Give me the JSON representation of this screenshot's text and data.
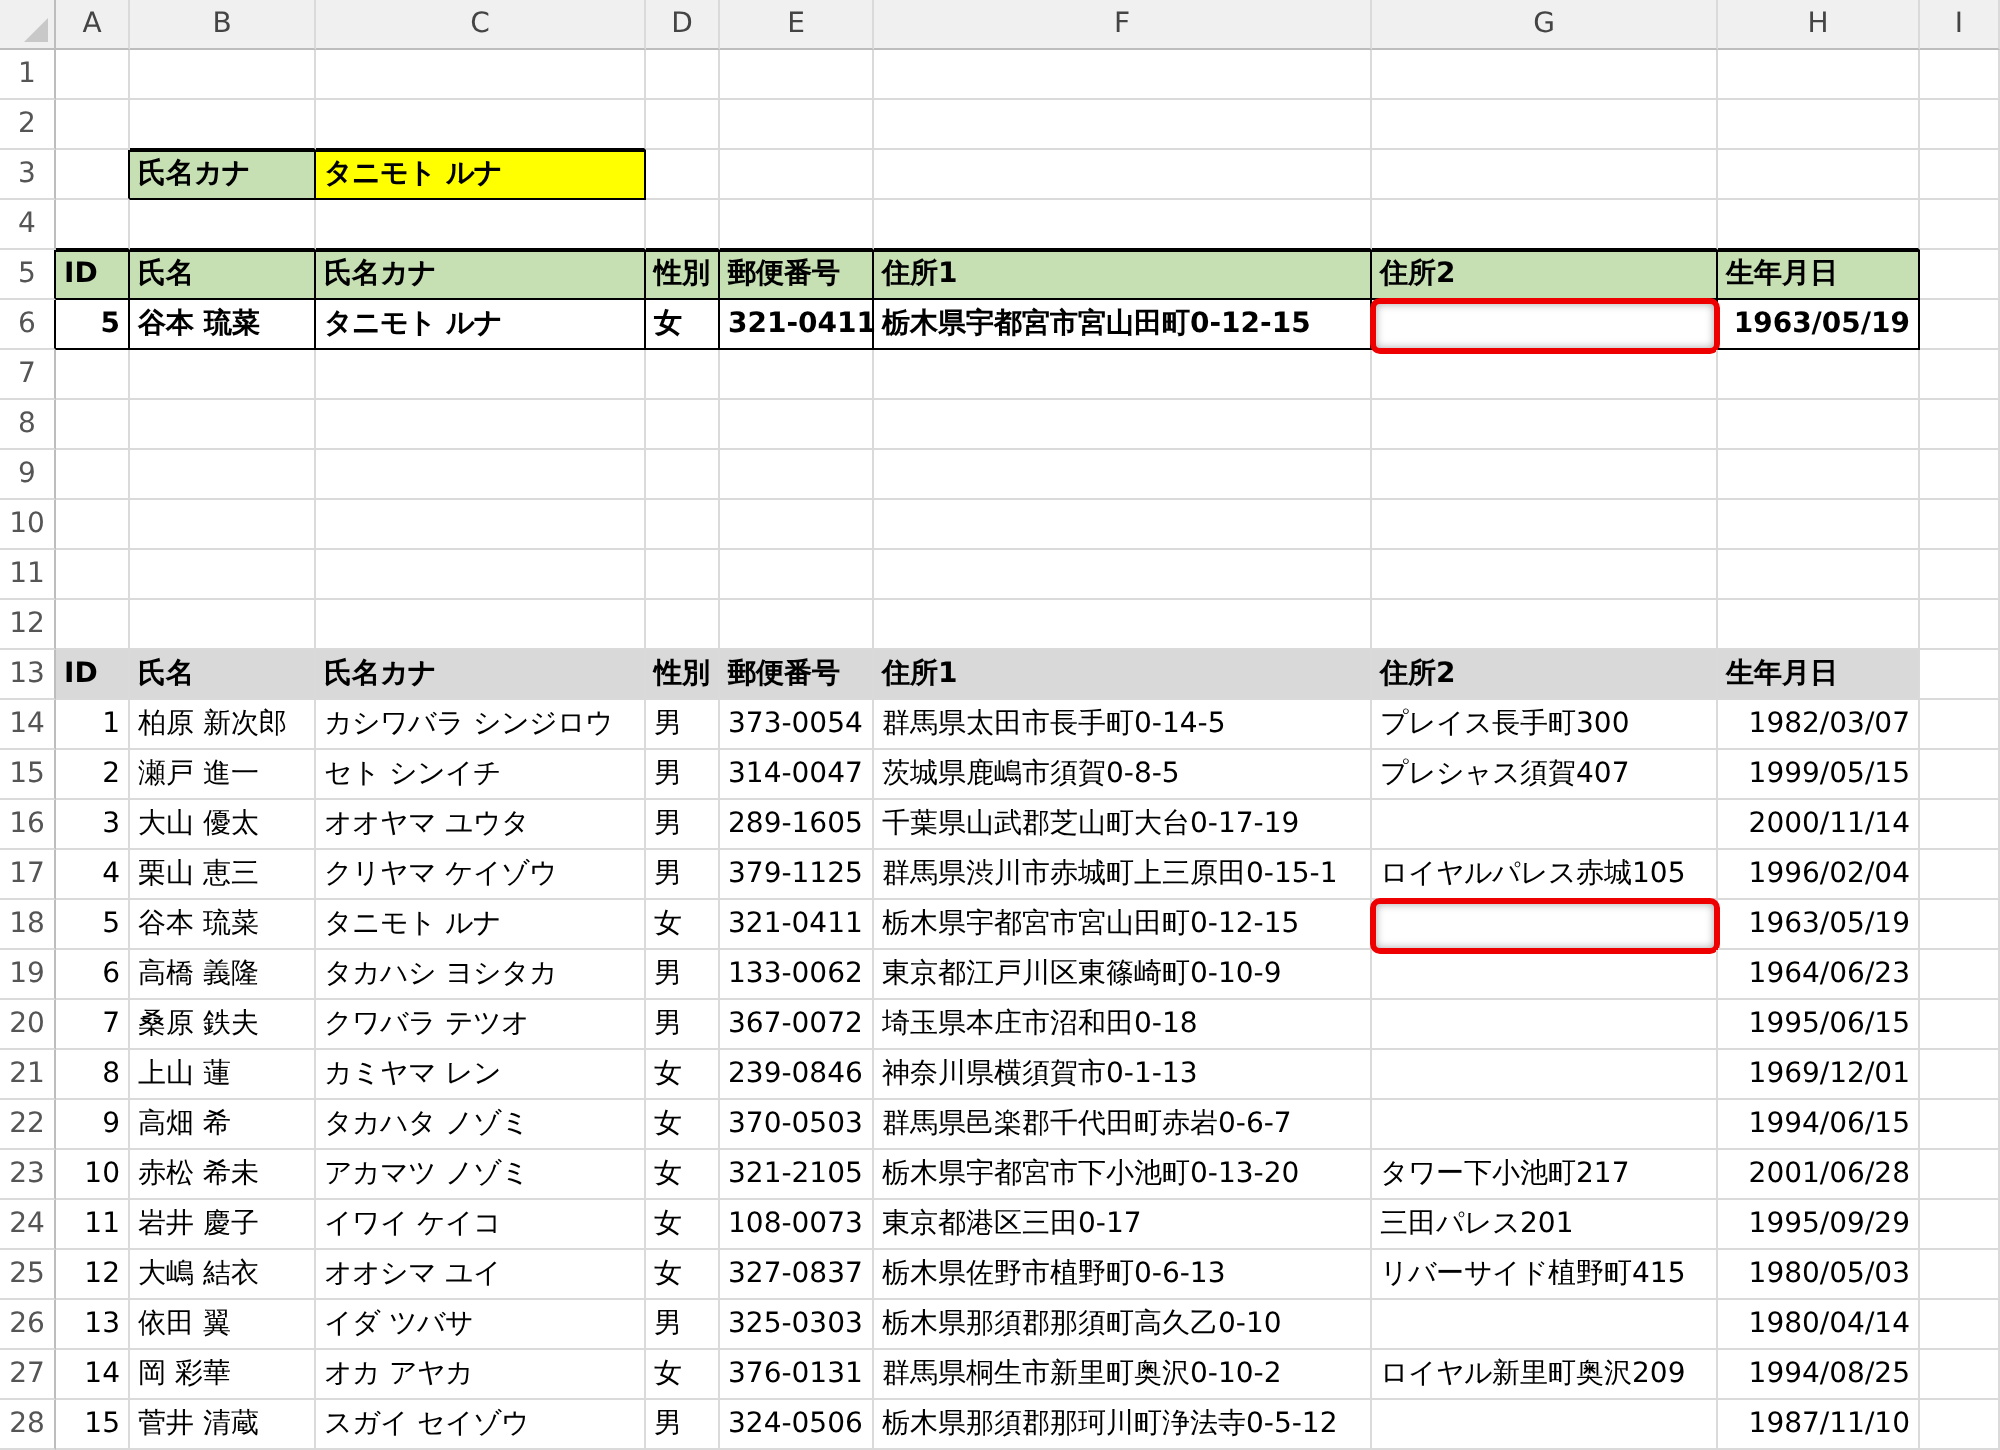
{
  "column_headers": [
    "A",
    "B",
    "C",
    "D",
    "E",
    "F",
    "G",
    "H",
    "I"
  ],
  "row_numbers": [
    "1",
    "2",
    "3",
    "4",
    "5",
    "6",
    "7",
    "8",
    "9",
    "10",
    "11",
    "12",
    "13",
    "14",
    "15",
    "16",
    "17",
    "18",
    "19",
    "20",
    "21",
    "22",
    "23",
    "24",
    "25",
    "26",
    "27",
    "28"
  ],
  "lookup": {
    "label": "氏名カナ",
    "value": "タニモト ルナ"
  },
  "result_table": {
    "columns": [
      "ID",
      "氏名",
      "氏名カナ",
      "性別",
      "郵便番号",
      "住所1",
      "住所2",
      "生年月日"
    ],
    "row": {
      "id": "5",
      "name": "谷本 琉菜",
      "kana": "タニモト ルナ",
      "gender": "女",
      "postal": "321-0411",
      "address1": "栃木県宇都宮市宮山田町0-12-15",
      "birthdate": "1963/05/19",
      "address2_highlighted": true
    }
  },
  "data_table": {
    "columns": [
      "ID",
      "氏名",
      "氏名カナ",
      "性別",
      "郵便番号",
      "住所1",
      "住所2",
      "生年月日"
    ],
    "rows": [
      {
        "id": "1",
        "name": "柏原 新次郎",
        "kana": "カシワバラ シンジロウ",
        "gender": "男",
        "postal": "373-0054",
        "address1": "群馬県太田市長手町0-14-5",
        "address2": "プレイス長手町300",
        "birthdate": "1982/03/07",
        "address2_highlighted": false
      },
      {
        "id": "2",
        "name": "瀬戸 進一",
        "kana": "セト シンイチ",
        "gender": "男",
        "postal": "314-0047",
        "address1": "茨城県鹿嶋市須賀0-8-5",
        "address2": "プレシャス須賀407",
        "birthdate": "1999/05/15",
        "address2_highlighted": false
      },
      {
        "id": "3",
        "name": "大山 優太",
        "kana": "オオヤマ ユウタ",
        "gender": "男",
        "postal": "289-1605",
        "address1": "千葉県山武郡芝山町大台0-17-19",
        "birthdate": "2000/11/14",
        "address2_highlighted": false
      },
      {
        "id": "4",
        "name": "栗山 恵三",
        "kana": "クリヤマ ケイゾウ",
        "gender": "男",
        "postal": "379-1125",
        "address1": "群馬県渋川市赤城町上三原田0-15-1",
        "address2": "ロイヤルパレス赤城105",
        "birthdate": "1996/02/04",
        "address2_highlighted": false
      },
      {
        "id": "5",
        "name": "谷本 琉菜",
        "kana": "タニモト ルナ",
        "gender": "女",
        "postal": "321-0411",
        "address1": "栃木県宇都宮市宮山田町0-12-15",
        "birthdate": "1963/05/19",
        "address2_highlighted": true
      },
      {
        "id": "6",
        "name": "高橋 義隆",
        "kana": "タカハシ ヨシタカ",
        "gender": "男",
        "postal": "133-0062",
        "address1": "東京都江戸川区東篠崎町0-10-9",
        "birthdate": "1964/06/23",
        "address2_highlighted": false
      },
      {
        "id": "7",
        "name": "桑原 鉄夫",
        "kana": "クワバラ テツオ",
        "gender": "男",
        "postal": "367-0072",
        "address1": "埼玉県本庄市沼和田0-18",
        "birthdate": "1995/06/15",
        "address2_highlighted": false
      },
      {
        "id": "8",
        "name": "上山 蓮",
        "kana": "カミヤマ レン",
        "gender": "女",
        "postal": "239-0846",
        "address1": "神奈川県横須賀市0-1-13",
        "birthdate": "1969/12/01",
        "address2_highlighted": false
      },
      {
        "id": "9",
        "name": "高畑 希",
        "kana": "タカハタ ノゾミ",
        "gender": "女",
        "postal": "370-0503",
        "address1": "群馬県邑楽郡千代田町赤岩0-6-7",
        "birthdate": "1994/06/15",
        "address2_highlighted": false
      },
      {
        "id": "10",
        "name": "赤松 希未",
        "kana": "アカマツ ノゾミ",
        "gender": "女",
        "postal": "321-2105",
        "address1": "栃木県宇都宮市下小池町0-13-20",
        "address2": "タワー下小池町217",
        "birthdate": "2001/06/28",
        "address2_highlighted": false
      },
      {
        "id": "11",
        "name": "岩井 慶子",
        "kana": "イワイ ケイコ",
        "gender": "女",
        "postal": "108-0073",
        "address1": "東京都港区三田0-17",
        "address2": "三田パレス201",
        "birthdate": "1995/09/29",
        "address2_highlighted": false
      },
      {
        "id": "12",
        "name": "大嶋 結衣",
        "kana": "オオシマ ユイ",
        "gender": "女",
        "postal": "327-0837",
        "address1": "栃木県佐野市植野町0-6-13",
        "address2": "リバーサイド植野町415",
        "birthdate": "1980/05/03",
        "address2_highlighted": false
      },
      {
        "id": "13",
        "name": "依田 翼",
        "kana": "イダ ツバサ",
        "gender": "男",
        "postal": "325-0303",
        "address1": "栃木県那須郡那須町高久乙0-10",
        "birthdate": "1980/04/14",
        "address2_highlighted": false
      },
      {
        "id": "14",
        "name": "岡 彩華",
        "kana": "オカ アヤカ",
        "gender": "女",
        "postal": "376-0131",
        "address1": "群馬県桐生市新里町奥沢0-10-2",
        "address2": "ロイヤル新里町奥沢209",
        "birthdate": "1994/08/25",
        "address2_highlighted": false
      },
      {
        "id": "15",
        "name": "菅井 清蔵",
        "kana": "スガイ セイゾウ",
        "gender": "男",
        "postal": "324-0506",
        "address1": "栃木県那須郡那珂川町浄法寺0-5-12",
        "birthdate": "1987/11/10",
        "address2_highlighted": false
      }
    ]
  }
}
